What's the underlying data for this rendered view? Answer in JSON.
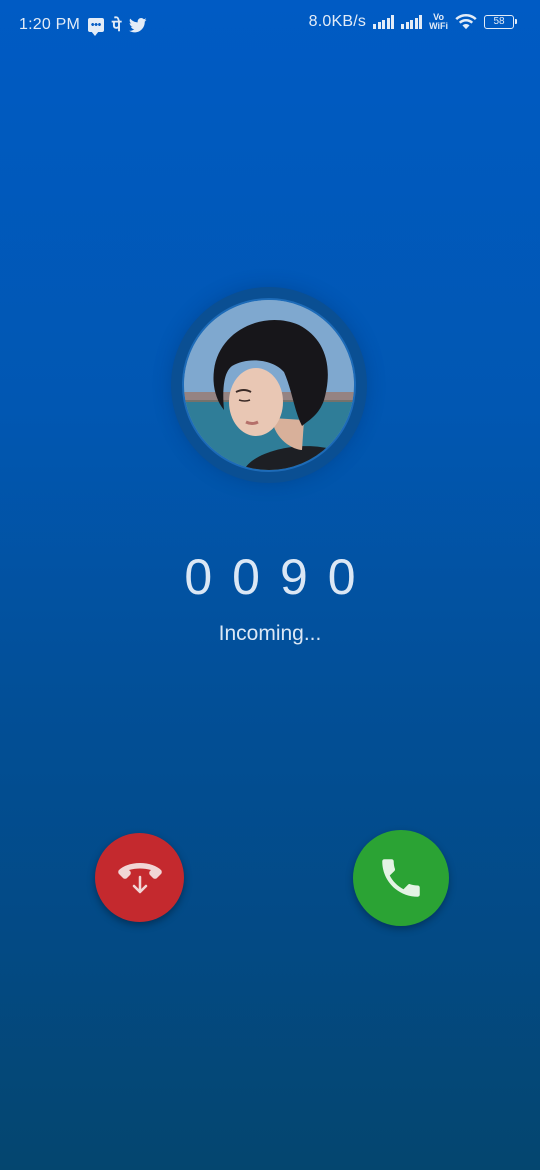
{
  "status_bar": {
    "time": "1:20 PM",
    "net_speed": "8.0KB/s",
    "vowifi_top": "Vo",
    "vowifi_bottom": "WiFi",
    "battery": "58",
    "hindi_glyph": "पे",
    "left_icons": [
      "message-icon",
      "paytm-glyph-icon",
      "twitter-icon"
    ],
    "right_icons": [
      "signal-bars-icon",
      "signal-bars-icon",
      "vowifi-icon",
      "wifi-icon",
      "battery-icon"
    ]
  },
  "caller": {
    "number": "0090",
    "status": "Incoming..."
  },
  "actions": {
    "decline_icon": "hangup-icon",
    "accept_icon": "phone-icon"
  },
  "colors": {
    "background_top": "#005bc4",
    "background_bottom": "#04466f",
    "decline": "#c4292e",
    "accept": "#2ba334",
    "avatar_ring": "#0a4f93"
  }
}
